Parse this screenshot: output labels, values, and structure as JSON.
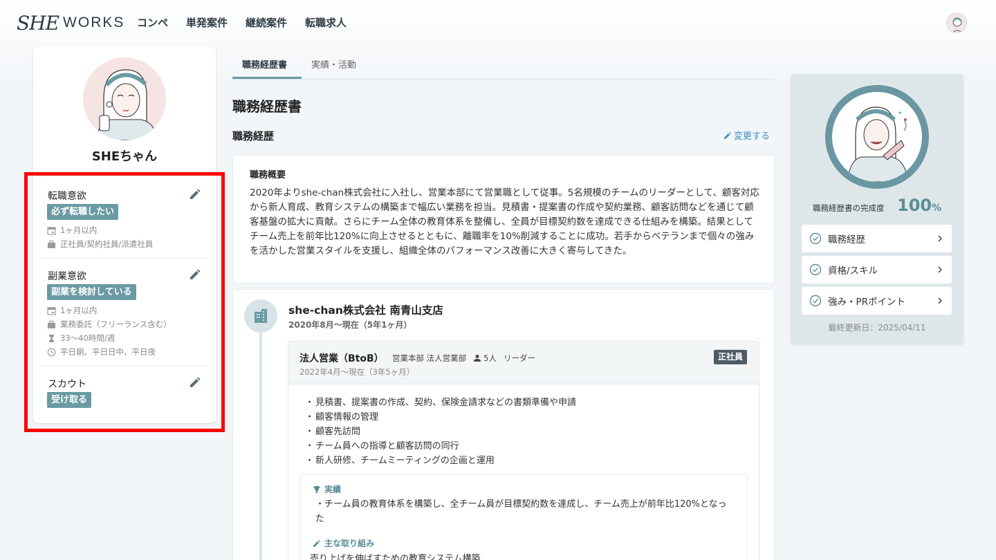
{
  "header": {
    "logo_script": "SHE",
    "logo_works": "WORKS",
    "nav": [
      "コンペ",
      "単発案件",
      "継続案件",
      "転職求人"
    ]
  },
  "profile": {
    "name": "SHEちゃん",
    "preferences": [
      {
        "title": "転職意欲",
        "tag": "必ず転職したい",
        "meta": [
          {
            "icon": "calendar-icon",
            "text": "1ヶ月以内"
          },
          {
            "icon": "briefcase-icon",
            "text": "正社員/契約社員/派遣社員"
          }
        ]
      },
      {
        "title": "副業意欲",
        "tag": "副業を検討している",
        "meta": [
          {
            "icon": "calendar-icon",
            "text": "1ヶ月以内"
          },
          {
            "icon": "briefcase-icon",
            "text": "業務委託（フリーランス含む）"
          },
          {
            "icon": "hourglass-icon",
            "text": "33〜40時間/週"
          },
          {
            "icon": "clock-icon",
            "text": "平日朝、平日日中、平日夜"
          }
        ]
      },
      {
        "title": "スカウト",
        "tag": "受け取る",
        "meta": []
      }
    ]
  },
  "tabs": [
    "職務経歴書",
    "実績・活動"
  ],
  "main": {
    "title": "職務経歴書",
    "subsection": "職務経歴",
    "change_link": "変更する",
    "summary_label": "職務概要",
    "summary_text": "2020年よりshe-chan株式会社に入社し、営業本部にて営業職として従事。5名規模のチームのリーダーとして、顧客対応から新人育成、教育システムの構築まで幅広い業務を担当。見積書・提案書の作成や契約業務、顧客訪問などを通じて顧客基盤の拡大に貢献。さらにチーム全体の教育体系を整備し、全員が目標契約数を達成できる仕組みを構築。結果としてチーム売上を前年比120%に向上させるとともに、離職率を10%削減することに成功。若手からベテランまで個々の強みを活かした営業スタイルを支援し、組織全体のパフォーマンス改善に大きく寄与してきた。",
    "company": {
      "name": "she-chan株式会社 南青山支店",
      "period": "2020年8月〜現在（5年1ヶ月）",
      "role": {
        "title": "法人営業（BtoB）",
        "dept": "営業本部 法人営業部",
        "members": "5人",
        "position": "リーダー",
        "period": "2022年4月〜現在（3年5ヶ月）",
        "badge": "正社員",
        "duties": [
          "見積書、提案書の作成、契約、保険金請求などの書類準備や申請",
          "顧客情報の管理",
          "顧客先訪問",
          "チーム員への指導と顧客訪問の同行",
          "新人研修、チームミーティングの企画と運用"
        ],
        "achievement_label": "実績",
        "achievement_text": "チーム員の教育体系を構築し、全チーム員が目標契約数を達成し、チーム売上が前年比120%となった",
        "effort_label": "主な取り組み",
        "effort_text": "売り上げを伸ばすための教育システム構築"
      }
    }
  },
  "sidebar_right": {
    "completion_label": "職務経歴書の完成度",
    "completion_value": "100",
    "completion_unit": "%",
    "items": [
      "職務経歴",
      "資格/スキル",
      "強み・PRポイント"
    ],
    "last_updated": "最終更新日：2025/04/11"
  },
  "colors": {
    "accent": "#6a9aa3",
    "link": "#3a8fc7",
    "highlight_box": "#ff0000",
    "badge": "#4e5c66"
  }
}
